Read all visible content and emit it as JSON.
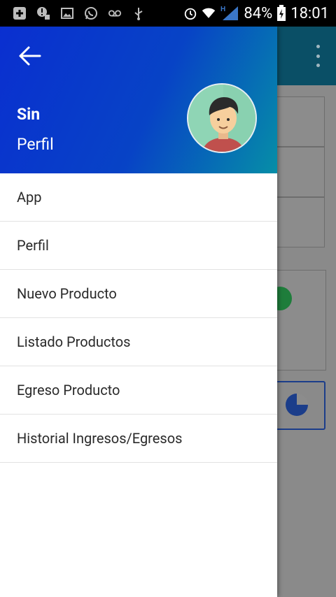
{
  "status_bar": {
    "battery_percent": "84%",
    "time": "18:01",
    "network_type": "H",
    "icons": [
      "add-icon",
      "alert-icon",
      "image-icon",
      "whatsapp-icon",
      "voicemail-icon",
      "usb-icon",
      "alarm-icon",
      "wifi-icon",
      "signal-icon",
      "battery-icon"
    ]
  },
  "drawer": {
    "header": {
      "name": "Sin",
      "subtitle": "Perfil"
    },
    "menu": [
      {
        "label": "App"
      },
      {
        "label": "Perfil"
      },
      {
        "label": "Nuevo Producto"
      },
      {
        "label": "Listado Productos"
      },
      {
        "label": "Egreso Producto"
      },
      {
        "label": "Historial Ingresos/Egresos"
      }
    ]
  },
  "colors": {
    "header_gradient_start": "#0a2fd0",
    "header_gradient_end": "#068ea7",
    "scrim": "#8a8a8a",
    "appbar": "#0a4f66"
  }
}
